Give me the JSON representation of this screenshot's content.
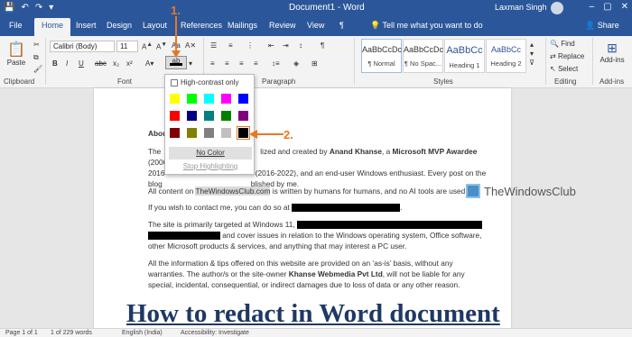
{
  "window": {
    "title": "Document1 - Word",
    "user": "Laxman Singh",
    "controls": [
      "–",
      "▢",
      "✕"
    ]
  },
  "tabs": [
    "File",
    "Home",
    "Insert",
    "Design",
    "Layout",
    "References",
    "Mailings",
    "Review",
    "View",
    "¶"
  ],
  "tellme": "Tell me what you want to do",
  "share": "Share",
  "ribbon": {
    "font_name": "Calibri (Body)",
    "font_size": "11",
    "paste_label": "Paste",
    "clipboard_label": "Clipboard",
    "font_label": "Font",
    "paragraph_label": "Paragraph",
    "styles_label": "Styles",
    "editing_label": "Editing",
    "addins_label": "Add-ins",
    "addins_btn": "Add-ins",
    "find": "Find",
    "replace": "Replace",
    "select": "Select",
    "styles": [
      {
        "sample": "AaBbCcDc",
        "name": "¶ Normal"
      },
      {
        "sample": "AaBbCcDc",
        "name": "¶ No Spac..."
      },
      {
        "sample": "AaBbCc",
        "name": "Heading 1"
      },
      {
        "sample": "AaBbCc",
        "name": "Heading 2"
      }
    ]
  },
  "highlight_popup": {
    "high_contrast": "High-contrast only",
    "colors": [
      "#ffff00",
      "#00ff00",
      "#00ffff",
      "#ff00ff",
      "#0000ff",
      "#ff0000",
      "#000080",
      "#008080",
      "#008000",
      "#800080",
      "#800000",
      "#808000",
      "#808080",
      "#c0c0c0",
      "#000000"
    ],
    "no_color": "No Color",
    "stop": "Stop Highlighting"
  },
  "annotations": {
    "one": "1.",
    "two": "2."
  },
  "document": {
    "heading_partial": "Abou",
    "p1": {
      "a": "The",
      "b": "lized and created by ",
      "author": "Anand Khanse",
      "c": ", a ",
      "mvp": "Microsoft MVP Awardee",
      "d": " (2006-",
      "e": "2016",
      "f": " (2016-2022), and an end-user Windows enthusiast. Every post on the",
      "g": "blog",
      "h": "blished by me."
    },
    "p2": {
      "a": "All content on ",
      "site": "TheWindowsClub.com",
      "b": " is written by humans for humans, and no AI tools are used."
    },
    "p3": "If you wish to contact me, you can do so at",
    "p4": {
      "a": "The site is primarily targeted at Windows 11,",
      "b": " and cover issues in relation to the Windows operating system, Office software,",
      "c": "other Microsoft products & services, and anything that may interest a PC user."
    },
    "p5": {
      "a": "All the information & tips offered on this website are provided on an ‘as-is’ basis, without any",
      "b": "warranties. The author/s or the site-owner ",
      "owner": "Khanse Webmedia Pvt Ltd",
      "c": ", will not be liable for any",
      "d": "special, incidental, consequential, or indirect damages due to loss of data or any other reason."
    }
  },
  "brand": "TheWindowsClub",
  "caption": "How to redact in Word document",
  "status": {
    "page": "Page 1 of 1",
    "words": "1 of 229 words",
    "lang": "English (India)",
    "access": "Accessibility: Investigate"
  }
}
